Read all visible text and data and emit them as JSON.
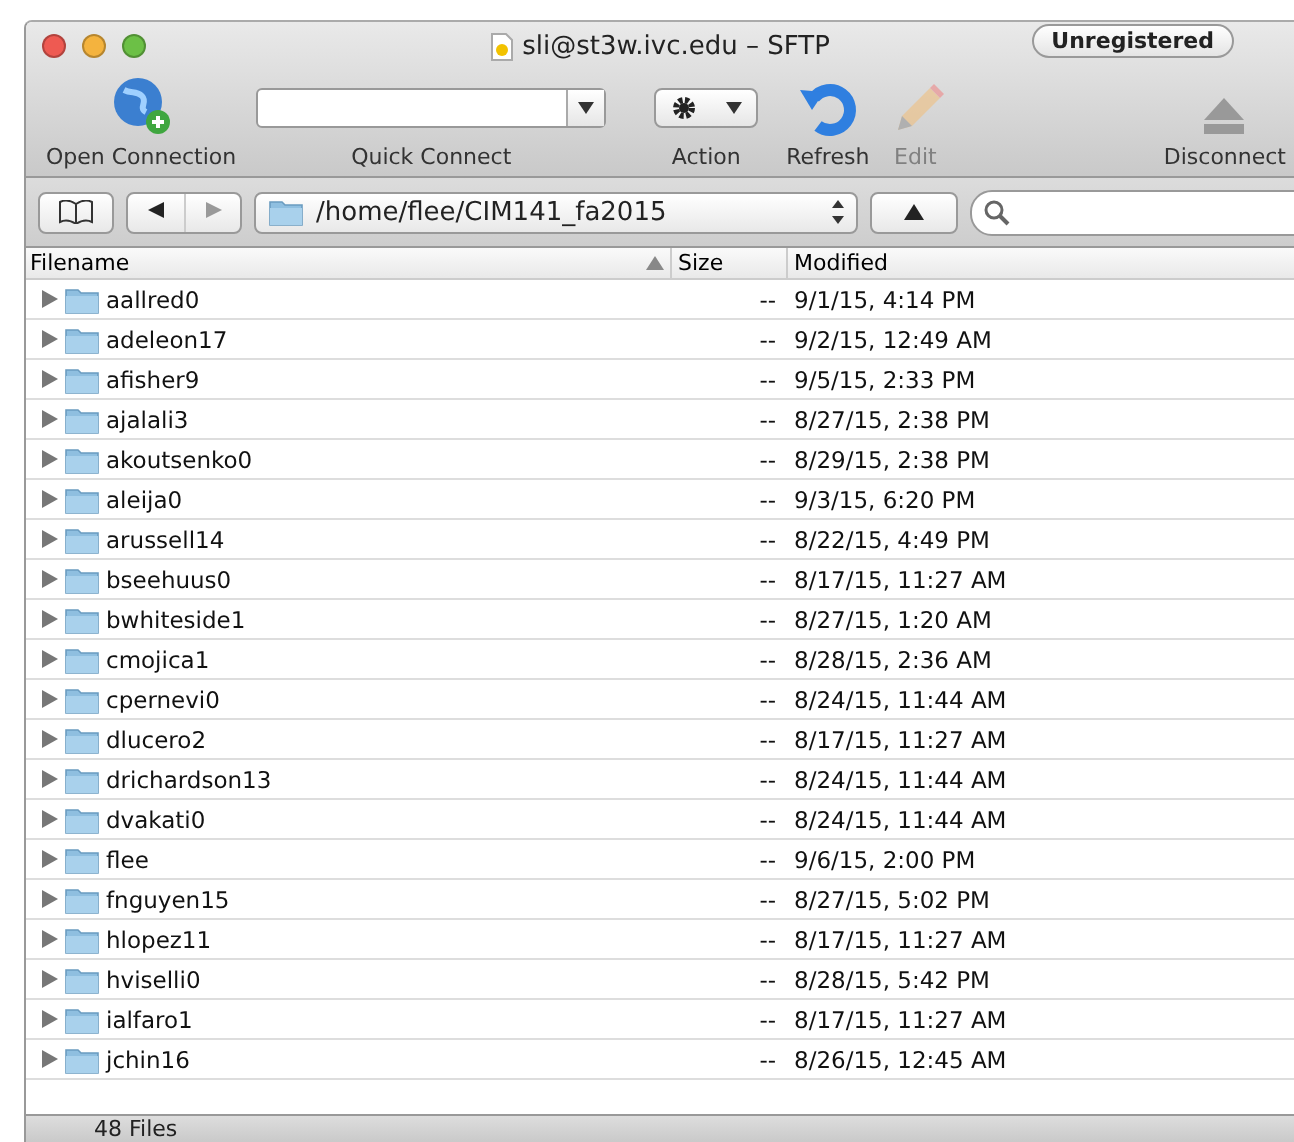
{
  "window": {
    "title": "sli@st3w.ivc.edu – SFTP",
    "badge": "Unregistered"
  },
  "toolbar": {
    "open_connection": "Open Connection",
    "quick_connect": {
      "label": "Quick Connect"
    },
    "action": "Action",
    "refresh": "Refresh",
    "edit": {
      "label": "Edit",
      "disabled": true
    },
    "disconnect": "Disconnect"
  },
  "path": "/home/flee/CIM141_fa2015",
  "table": {
    "columns": [
      "Filename",
      "Size",
      "Modified"
    ],
    "rows": [
      {
        "name": "aallred0",
        "size": "--",
        "modified": "9/1/15, 4:14 PM",
        "expanded": false
      },
      {
        "name": "adeleon17",
        "size": "--",
        "modified": "9/2/15, 12:49 AM",
        "expanded": false
      },
      {
        "name": "afisher9",
        "size": "--",
        "modified": "9/5/15, 2:33 PM",
        "expanded": false
      },
      {
        "name": "ajalali3",
        "size": "--",
        "modified": "8/27/15, 2:38 PM",
        "expanded": false
      },
      {
        "name": "akoutsenko0",
        "size": "--",
        "modified": "8/29/15, 2:38 PM",
        "expanded": false
      },
      {
        "name": "aleija0",
        "size": "--",
        "modified": "9/3/15, 6:20 PM",
        "expanded": false
      },
      {
        "name": "arussell14",
        "size": "--",
        "modified": "8/22/15, 4:49 PM",
        "expanded": false
      },
      {
        "name": "bseehuus0",
        "size": "--",
        "modified": "8/17/15, 11:27 AM",
        "expanded": false
      },
      {
        "name": "bwhiteside1",
        "size": "--",
        "modified": "8/27/15, 1:20 AM",
        "expanded": false
      },
      {
        "name": "cmojica1",
        "size": "--",
        "modified": "8/28/15, 2:36 AM",
        "expanded": false
      },
      {
        "name": "cpernevi0",
        "size": "--",
        "modified": "8/24/15, 11:44 AM",
        "expanded": false
      },
      {
        "name": "dlucero2",
        "size": "--",
        "modified": "8/17/15, 11:27 AM",
        "expanded": false
      },
      {
        "name": "drichardson13",
        "size": "--",
        "modified": "8/24/15, 11:44 AM",
        "expanded": false
      },
      {
        "name": "dvakati0",
        "size": "--",
        "modified": "8/24/15, 11:44 AM",
        "expanded": false
      },
      {
        "name": "flee",
        "size": "--",
        "modified": "9/6/15, 2:00 PM",
        "expanded": false
      },
      {
        "name": "fnguyen15",
        "size": "--",
        "modified": "8/27/15, 5:02 PM",
        "expanded": false
      },
      {
        "name": "hlopez11",
        "size": "--",
        "modified": "8/17/15, 11:27 AM",
        "expanded": false
      },
      {
        "name": "hviselli0",
        "size": "--",
        "modified": "8/28/15, 5:42 PM",
        "expanded": false
      },
      {
        "name": "ialfaro1",
        "size": "--",
        "modified": "8/17/15, 11:27 AM",
        "expanded": false
      },
      {
        "name": "jchin16",
        "size": "--",
        "modified": "8/26/15, 12:45 AM",
        "expanded": false
      }
    ]
  },
  "status_bar": "48 Files"
}
